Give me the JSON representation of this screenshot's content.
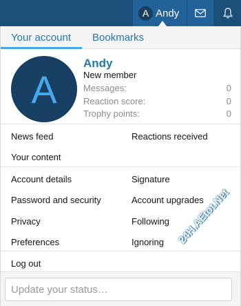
{
  "topbar": {
    "user": {
      "avatar_letter": "A",
      "name": "Andy"
    },
    "icons": [
      "envelope-icon",
      "bell-icon"
    ]
  },
  "tabs": [
    {
      "label": "Your account",
      "active": true
    },
    {
      "label": "Bookmarks",
      "active": false
    }
  ],
  "profile": {
    "avatar_letter": "A",
    "name": "Andy",
    "title": "New member",
    "stats": [
      {
        "label": "Messages:",
        "value": "0"
      },
      {
        "label": "Reaction score:",
        "value": "0"
      },
      {
        "label": "Trophy points:",
        "value": "0"
      }
    ]
  },
  "links_group1": {
    "left": [
      "News feed",
      "Your content"
    ],
    "right": [
      "Reactions received"
    ]
  },
  "links_group2": {
    "left": [
      "Account details",
      "Password and security",
      "Privacy",
      "Preferences"
    ],
    "right": [
      "Signature",
      "Account upgrades",
      "Following",
      "Ignoring"
    ]
  },
  "logout_label": "Log out",
  "status": {
    "placeholder": "Update your status…",
    "value": ""
  },
  "watermark": "24H.AEtot.Net",
  "colors": {
    "topbar": "#1b4f7a",
    "topbar_active": "#236199",
    "link_blue": "#2577b1",
    "tab_underline": "#47a7eb",
    "avatar_bg": "#163f63"
  }
}
